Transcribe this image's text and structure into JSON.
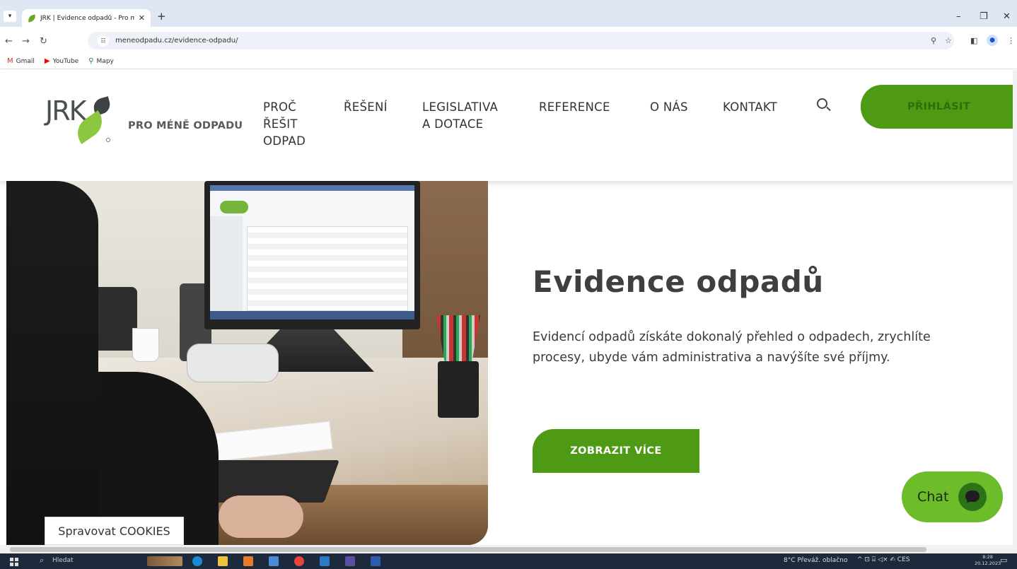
{
  "browser": {
    "tab_title": "JRK | Evidence odpadů - Pro mé",
    "new_tab_icon": "+",
    "url": "meneodpadu.cz/evidence-odpadu/",
    "bookmarks": [
      {
        "label": "Gmail",
        "icon": "gmail-icon"
      },
      {
        "label": "YouTube",
        "icon": "youtube-icon"
      },
      {
        "label": "Mapy",
        "icon": "map-pin-icon"
      }
    ]
  },
  "header": {
    "logo_text": "JRK",
    "tagline": "PRO MÉNĚ ODPADU",
    "nav": [
      {
        "label": "PROČ\nŘEŠIT\nODPAD"
      },
      {
        "label": "ŘEŠENÍ"
      },
      {
        "label": "LEGISLATIVA\nA DOTACE"
      },
      {
        "label": "REFERENCE"
      },
      {
        "label": "O NÁS"
      },
      {
        "label": "KONTAKT"
      }
    ],
    "login_label": "PŘIHLÁSIT"
  },
  "hero": {
    "title": "Evidence odpadů",
    "description": "Evidencí odpadů získáte dokonalý přehled o odpadech, zrychlíte procesy, ubyde vám administrativa a navýšíte své příjmy.",
    "cta_label": "ZOBRAZIT VÍCE"
  },
  "cookies_label": "Spravovat COOKIES",
  "chat_label": "Chat",
  "colors": {
    "brand_green": "#4e9a15",
    "chat_green": "#6dbc2a",
    "logo_leaf": "#8dc63f"
  },
  "taskbar": {
    "search_text": "Hledat",
    "weather": "8°C  Převáž. oblačno",
    "lang": "CES",
    "time": "8:28",
    "date": "20.12.2023"
  }
}
